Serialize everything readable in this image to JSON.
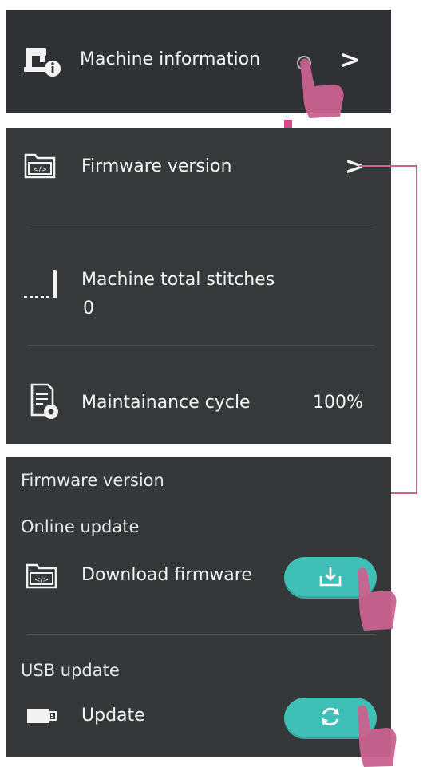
{
  "machine_info": {
    "label": "Machine information"
  },
  "settings": {
    "firmware_label": "Firmware version",
    "stitches_label": "Machine total stitches",
    "stitches_value": "0",
    "maintenance_label": "Maintainance cycle",
    "maintenance_value": "100%"
  },
  "firmware_screen": {
    "title": "Firmware version",
    "online_section": "Online update",
    "download_label": "Download firmware",
    "usb_section": "USB update",
    "update_label": "Update"
  },
  "colors": {
    "panel": "#333538",
    "accent_teal": "#3fbfb5",
    "pointer_pink": "#e0478a",
    "hand_pink": "#c9628f"
  },
  "icons": {
    "machine": "sewing-machine-info-icon",
    "firmware": "folder-code-icon",
    "stitches": "needle-stitch-icon",
    "maintenance": "document-gear-icon",
    "download": "download-icon",
    "usb": "usb-drive-icon",
    "update": "refresh-icon"
  }
}
